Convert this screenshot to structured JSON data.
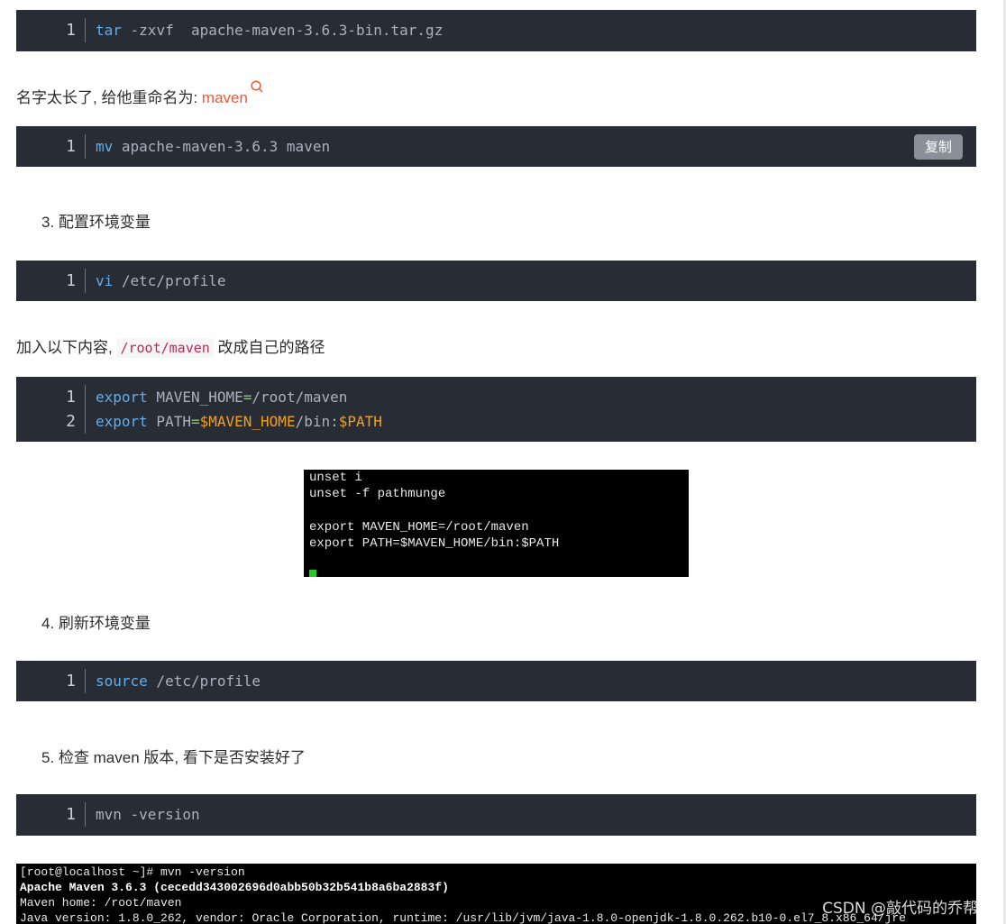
{
  "blocks": {
    "tar": {
      "line_no": "1",
      "cmd": "tar",
      "args": " -zxvf  apache-maven-3.6.3-bin.tar.gz"
    },
    "mv": {
      "line_no": "1",
      "cmd": "mv",
      "args": " apache-maven-3.6.3 maven",
      "copy_label": "复制"
    },
    "vi": {
      "line_no": "1",
      "cmd": "vi",
      "args": " /etc/profile"
    },
    "export": {
      "line1_no": "1",
      "line1_kw": "export",
      "line1_name": " MAVEN_HOME",
      "line1_eq": "=",
      "line1_val": "/root/maven",
      "line2_no": "2",
      "line2_kw": "export",
      "line2_name": " PATH",
      "line2_eq": "=",
      "line2_var1": "$MAVEN_HOME",
      "line2_mid": "/bin:",
      "line2_var2": "$PATH"
    },
    "source": {
      "line_no": "1",
      "cmd": "source",
      "args": " /etc/profile"
    },
    "mvn": {
      "line_no": "1",
      "cmd": "mvn -version"
    }
  },
  "text": {
    "rename": "名字太长了, 给他重命名为: ",
    "rename_link": "maven",
    "step3": "3. 配置环境变量",
    "add_prefix": "加入以下内容, ",
    "add_code": "/root/maven",
    "add_suffix": " 改成自己的路径",
    "step4": "4. 刷新环境变量",
    "step5": "5. 检查 maven 版本, 看下是否安装好了"
  },
  "terminal1": {
    "lines": [
      "unset i",
      "unset -f pathmunge",
      "",
      "export MAVEN_HOME=/root/maven",
      "export PATH=$MAVEN_HOME/bin:$PATH"
    ]
  },
  "terminal2": {
    "line1": "[root@localhost ~]# mvn -version",
    "line2": "Apache Maven 3.6.3 (cecedd343002696d0abb50b32b541b8a6ba2883f)",
    "line3": "Maven home: /root/maven",
    "line4": "Java version: 1.8.0_262, vendor: Oracle Corporation, runtime: /usr/lib/jvm/java-1.8.0-openjdk-1.8.0.262.b10-0.el7_8.x86_64/jre"
  },
  "watermark": "CSDN @敲代码的乔帮主"
}
